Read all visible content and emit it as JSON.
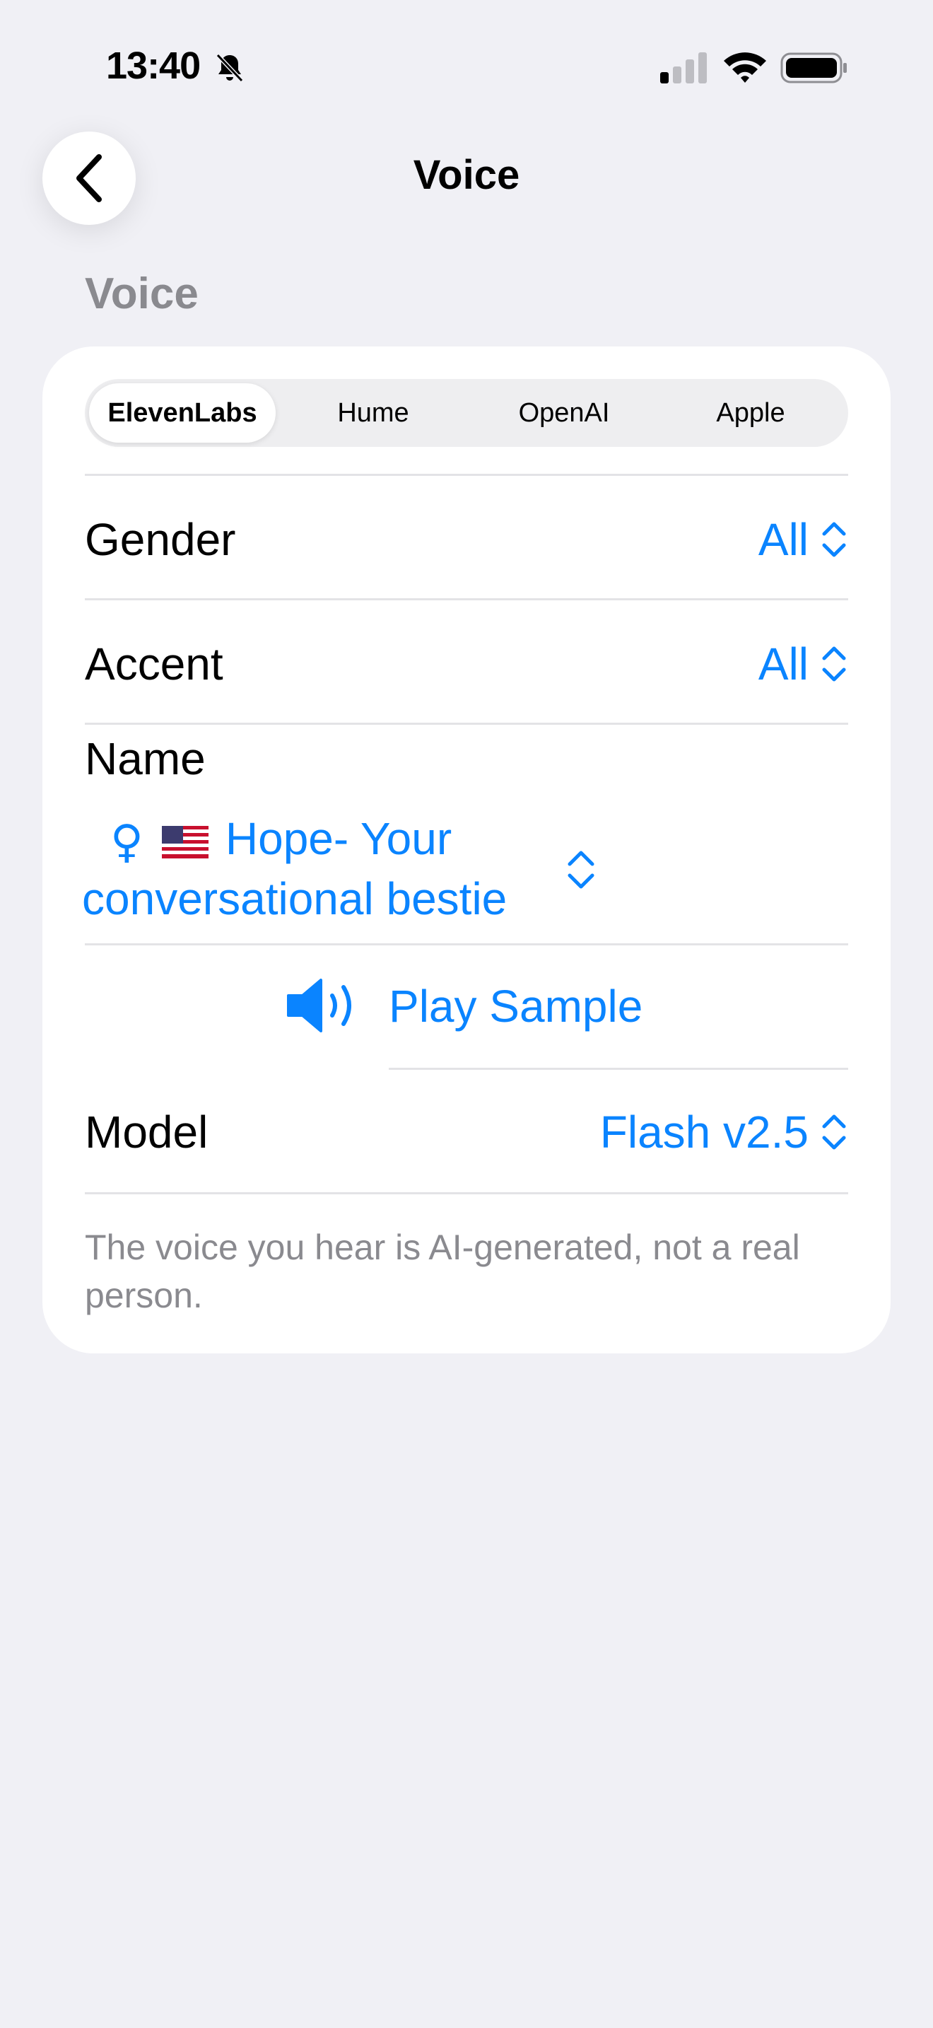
{
  "status_bar": {
    "time": "13:40",
    "icons": [
      "bell-slash-icon",
      "cellular-signal-icon",
      "wifi-icon",
      "battery-icon"
    ]
  },
  "nav": {
    "title": "Voice",
    "back_icon": "chevron-left-icon"
  },
  "section": {
    "header": "Voice"
  },
  "providers": {
    "items": [
      "ElevenLabs",
      "Hume",
      "OpenAI",
      "Apple"
    ],
    "selected": "ElevenLabs"
  },
  "gender": {
    "label": "Gender",
    "value": "All"
  },
  "accent": {
    "label": "Accent",
    "value": "All"
  },
  "name": {
    "label": "Name",
    "line1": "Hope- Your",
    "line2": "conversational bestie",
    "gender_symbol": "♀",
    "flag_icon": "us-flag-icon"
  },
  "sample": {
    "label": "Play Sample",
    "icon": "speaker-wave-icon"
  },
  "model": {
    "label": "Model",
    "value": "Flash v2.5"
  },
  "footer": {
    "text": "The voice you hear is AI-generated, not a real person."
  },
  "colors": {
    "accent": "#0A84FF",
    "background": "#F0F0F5",
    "secondary_text": "#8A8A8F"
  }
}
